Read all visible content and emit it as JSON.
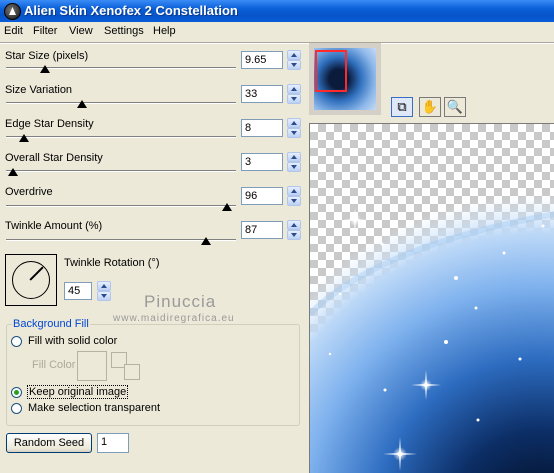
{
  "window": {
    "title": "Alien Skin Xenofex 2 Constellation"
  },
  "menu": [
    "Edit",
    "Filter",
    "View",
    "Settings",
    "Help"
  ],
  "sliders": [
    {
      "label": "Star Size (pixels)",
      "value": "9.65",
      "level": 0.17
    },
    {
      "label": "Size Variation",
      "value": "33",
      "level": 0.33
    },
    {
      "label": "Edge Star Density",
      "value": "8",
      "level": 0.08
    },
    {
      "label": "Overall Star Density",
      "value": "3",
      "level": 0.03
    },
    {
      "label": "Overdrive",
      "value": "96",
      "level": 0.96
    },
    {
      "label": "Twinkle Amount (%)",
      "value": "87",
      "level": 0.87
    }
  ],
  "rotation": {
    "label": "Twinkle Rotation (°)",
    "value": "45"
  },
  "background_fill": {
    "title": "Background Fill",
    "options": [
      {
        "label": "Fill with solid color",
        "checked": false
      },
      {
        "label": "Keep original image",
        "checked": true
      },
      {
        "label": "Make selection transparent",
        "checked": false
      }
    ],
    "fill_color_label": "Fill Color"
  },
  "random_seed": {
    "button_label": "Random Seed",
    "value": "1"
  },
  "watermark": {
    "name": "Pinuccia",
    "url": "www.maidiregrafica.eu"
  },
  "toolbar": {
    "tools": [
      "preview-compare-icon",
      "hand-icon",
      "zoom-icon"
    ]
  },
  "colors": {
    "title_bar": "#0a5fd8",
    "panel": "#ece9d8",
    "accent_label": "#0046d5",
    "thumb_marker": "#ff2a2a"
  }
}
